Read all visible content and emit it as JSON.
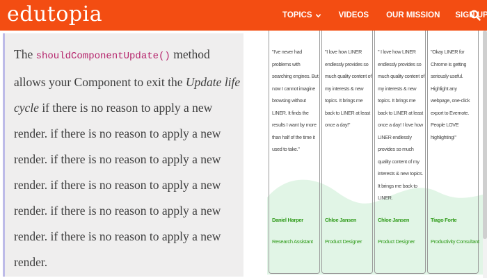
{
  "header": {
    "logo": "edutopia",
    "nav": [
      {
        "label": "TOPICS"
      },
      {
        "label": "VIDEOS"
      },
      {
        "label": "OUR MISSION"
      },
      {
        "label": "SIGN UP"
      }
    ],
    "search_icon": "search-icon",
    "brand_color": "#f34d12"
  },
  "content": {
    "text_before_code": "The ",
    "code": "shouldComponentUpdate()",
    "text_after_code": " method allows your Component to exit the ",
    "italic": "Update life cycle",
    "text_after_italic": " if there is no reason to apply a new render. if there is no reason to apply a new render. if there is no reason to apply a new render. if there is no reason to apply a new render. if there is no reason to apply a new render. if there is no reason to apply a new render."
  },
  "testimonials": [
    {
      "quote": "\"I've never had problems with searching engines. But now I cannot imagine browsing without LINER. It finds the results I want by more than half of the time it used to take.\"",
      "name": "Daniel Harper",
      "role": "Research Assistant"
    },
    {
      "quote": "\"I love how LINER endlessly provides so much quality content of my interests & new topics. It brings me back to LINER at least once a day!\"",
      "name": "Chloe Jansen",
      "role": "Product Designer"
    },
    {
      "quote": "\" I love how LINER endlessly provides so much quality content of my interests & new topics. It brings me back to LINER at least once a day! I love how LINER endlessly provides so much quality content of my interests & new topics. It brings me back to LINER.",
      "name": "Chloe Jansen",
      "role": "Product Designer"
    },
    {
      "quote": "\"Okay LINER for Chrome is getting seriously useful. Highlight any webpage, one-click export to Evernote. People LOVE highlighting!\"",
      "name": "Tiago Forte",
      "role": "Productivity Consultant"
    }
  ]
}
